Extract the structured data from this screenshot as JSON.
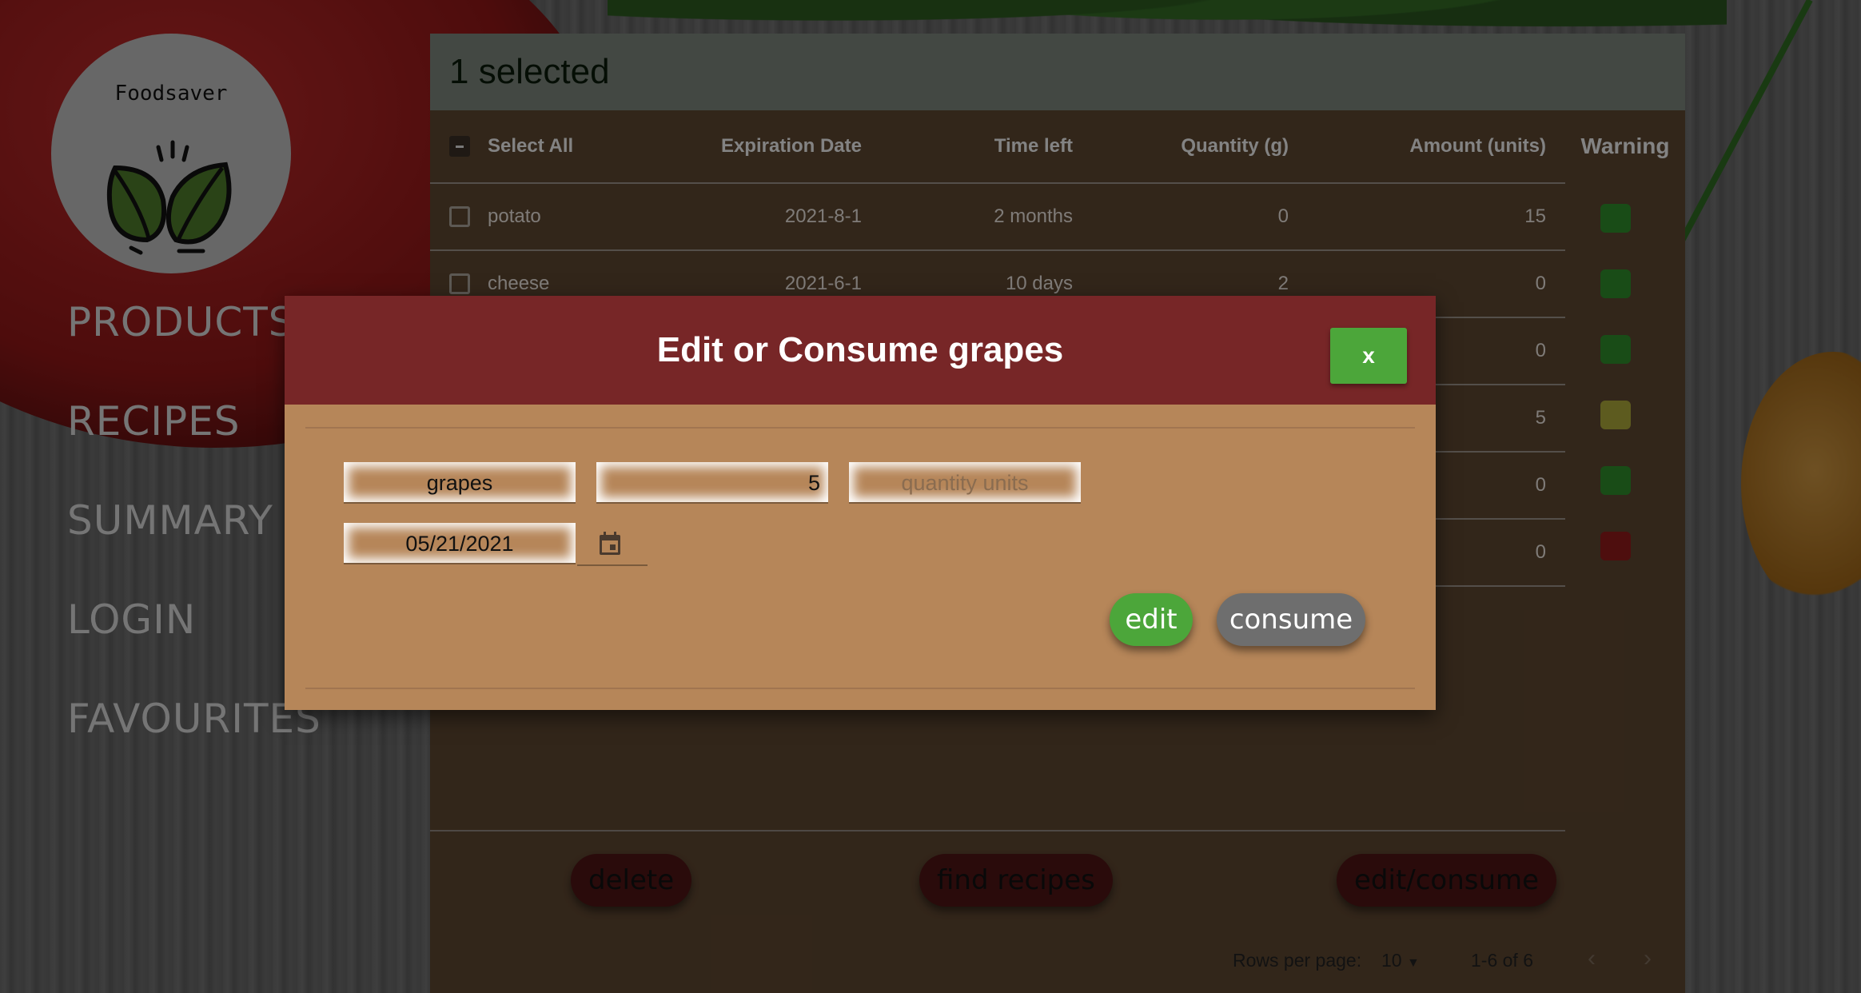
{
  "app": {
    "logo_text": "Foodsaver"
  },
  "nav": {
    "items": [
      "PRODUCTS",
      "RECIPES",
      "SUMMARY",
      "LOGIN",
      "FAVOURITES"
    ]
  },
  "panel": {
    "title": "1 selected",
    "columns": {
      "select_all": "Select All",
      "expiration": "Expiration Date",
      "time_left": "Time left",
      "quantity": "Quantity (g)",
      "amount": "Amount (units)",
      "warning": "Warning"
    },
    "rows": [
      {
        "name": "potato",
        "expiration": "2021-8-1",
        "time_left": "2 months",
        "quantity": "0",
        "amount": "15",
        "warning_color": "#2f8a2a"
      },
      {
        "name": "cheese",
        "expiration": "2021-6-1",
        "time_left": "10 days",
        "quantity": "2",
        "amount": "0",
        "warning_color": "#2f8a2a"
      },
      {
        "name": "",
        "expiration": "",
        "time_left": "",
        "quantity": "",
        "amount": "0",
        "warning_color": "#2f8a2a"
      },
      {
        "name": "",
        "expiration": "",
        "time_left": "",
        "quantity": "",
        "amount": "5",
        "warning_color": "#a9a63a"
      },
      {
        "name": "",
        "expiration": "",
        "time_left": "",
        "quantity": "",
        "amount": "0",
        "warning_color": "#2f8a2a"
      },
      {
        "name": "",
        "expiration": "",
        "time_left": "",
        "quantity": "",
        "amount": "0",
        "warning_color": "#8e1a1a"
      }
    ],
    "actions": {
      "delete": "delete",
      "find_recipes": "find recipes",
      "edit_consume": "edit/consume"
    },
    "pagination": {
      "rows_per_page_label": "Rows per page:",
      "rows_per_page": "10",
      "range": "1-6 of 6"
    }
  },
  "modal": {
    "title": "Edit or Consume grapes",
    "close_label": "x",
    "name_value": "grapes",
    "quantity_value": "5",
    "units_placeholder": "quantity units",
    "date_value": "05/21/2021",
    "edit_label": "edit",
    "consume_label": "consume"
  },
  "colors": {
    "accent_green": "#4ca63a",
    "modal_header": "#772627",
    "modal_body": "#b68659"
  }
}
